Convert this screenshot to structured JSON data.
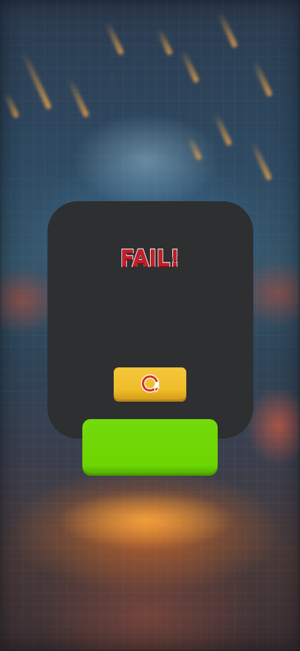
{
  "result": {
    "title": "FAIL!",
    "title_color": "#c0202a"
  },
  "replay_button": {
    "icon": "replay-icon",
    "color": "#f0be2e"
  },
  "primary_button": {
    "label": "",
    "color": "#6cd600"
  },
  "panel": {
    "color": "#2e2f31"
  }
}
